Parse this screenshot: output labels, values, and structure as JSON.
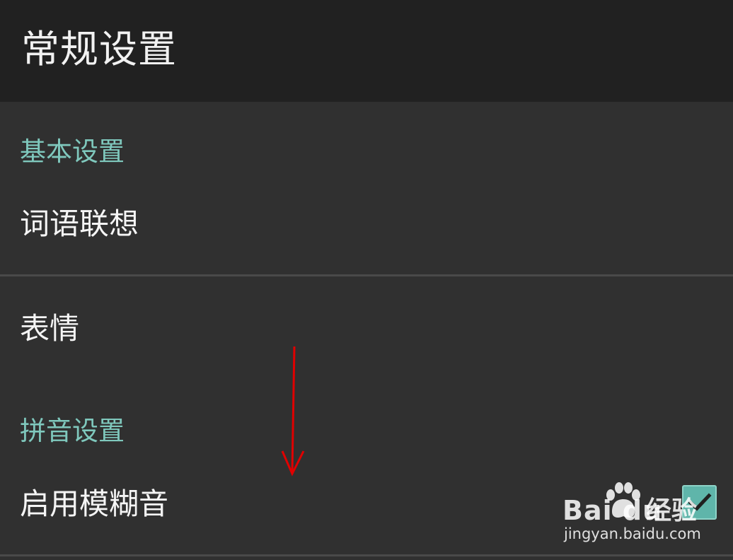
{
  "header": {
    "title": "常规设置"
  },
  "sections": [
    {
      "header": "基本设置",
      "items": [
        {
          "label": "词语联想"
        },
        {
          "label": "表情"
        }
      ]
    },
    {
      "header": "拼音设置",
      "items": [
        {
          "label": "启用模糊音",
          "checked": true
        }
      ]
    }
  ],
  "watermark": {
    "brand": "Bai  du",
    "product": "经验",
    "url": "jingyan.baidu.com"
  },
  "colors": {
    "title_bar": "#212121",
    "background": "#303030",
    "section_header": "#7fc8bd",
    "checkbox": "#5fb5aa",
    "annotation_arrow": "#e00000"
  },
  "icons": [
    "check-icon",
    "annotation-arrow",
    "baidu-paw-logo"
  ]
}
